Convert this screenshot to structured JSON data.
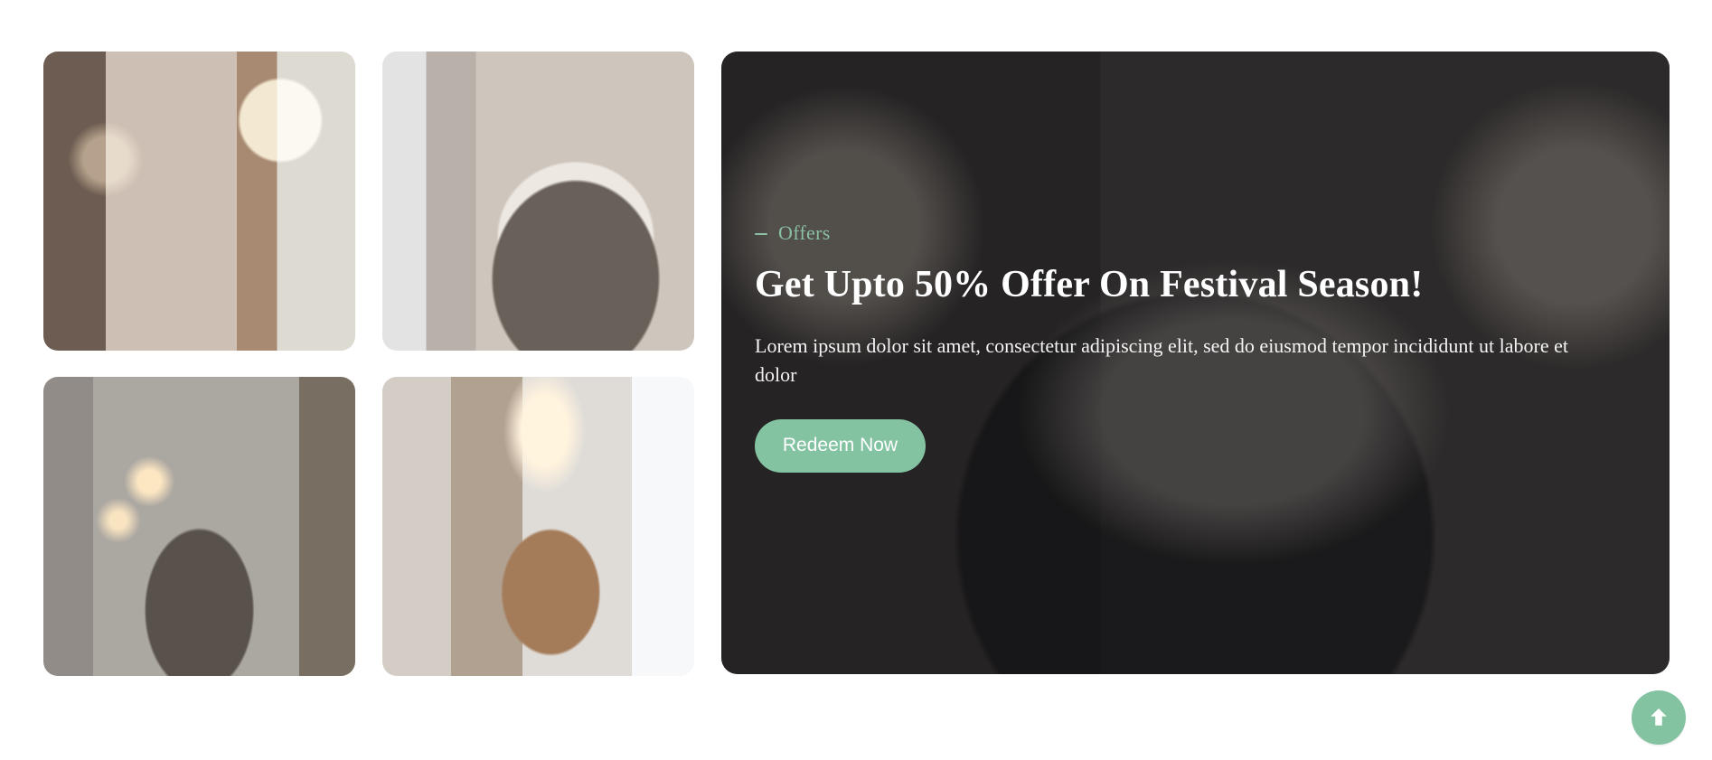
{
  "images": {
    "tile_1": {
      "icon": "kitchen-interior-image"
    },
    "tile_2": {
      "icon": "bedroom-interior-image"
    },
    "tile_3": {
      "icon": "dining-room-interior-image"
    },
    "tile_4": {
      "icon": "breakfast-nook-interior-image"
    }
  },
  "offer": {
    "eyebrow": "Offers",
    "headline": "Get Upto 50% Offer On Festival Season!",
    "body": "Lorem ipsum dolor sit amet, consectetur adipiscing elit, sed do eiusmod tempor incididunt ut labore et dolor",
    "cta_label": "Redeem Now",
    "accent": "#84c3a2"
  },
  "back_to_top": {
    "icon": "arrow-up-icon"
  }
}
